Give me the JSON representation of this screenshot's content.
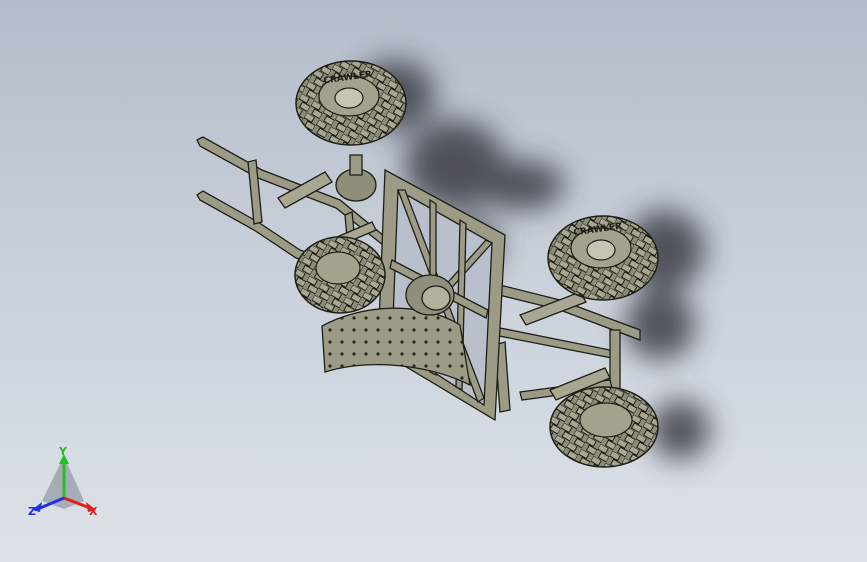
{
  "viewport": {
    "background_top": "#b4bccb",
    "background_bottom": "#dde2e8"
  },
  "model": {
    "part_color": "#9c9c86",
    "edge_color": "#1e1e18",
    "tire_text": "CRAWLER",
    "components": [
      "chassis-frame",
      "tire",
      "tire",
      "tire",
      "tire",
      "shock-absorber",
      "shock-absorber",
      "rear-panel",
      "mud-flap",
      "gearbox"
    ]
  },
  "triad": {
    "labels": {
      "x": "X",
      "y": "Y",
      "z": "Z"
    },
    "colors": {
      "x": "#e02020",
      "y": "#20c020",
      "z": "#2030e0"
    }
  }
}
